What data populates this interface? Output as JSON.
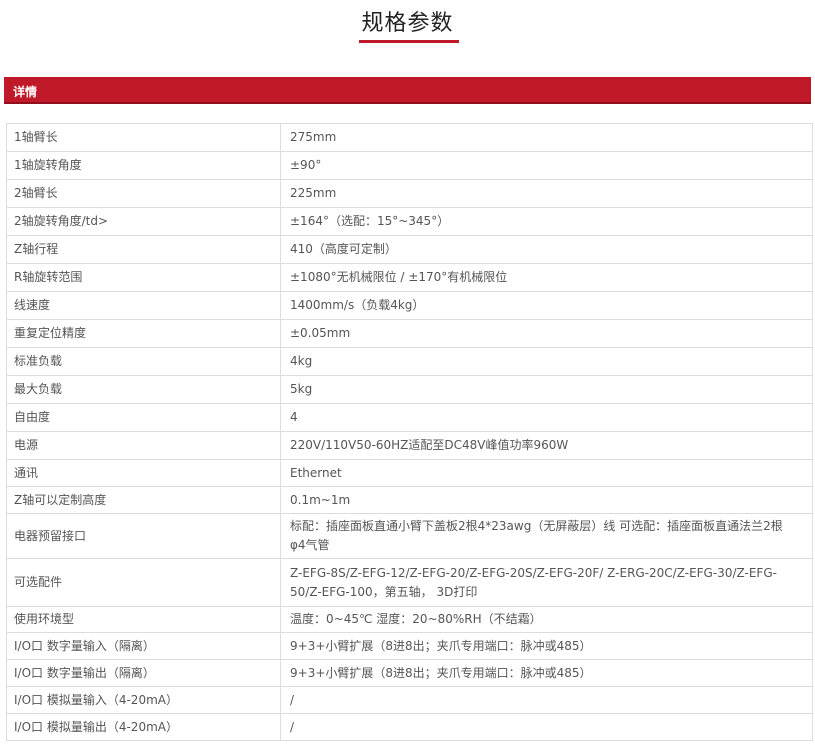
{
  "header": {
    "title": "规格参数"
  },
  "section": {
    "label": "详情"
  },
  "spec_rows": [
    {
      "key": "1轴臂长",
      "value": "275mm"
    },
    {
      "key": "1轴旋转角度",
      "value": "±90°"
    },
    {
      "key": "2轴臂长",
      "value": "225mm"
    },
    {
      "key": "2轴旋转角度/td>",
      "value": "±164°（选配：15°~345°）"
    },
    {
      "key": "Z轴行程",
      "value": "410（高度可定制）"
    },
    {
      "key": "R轴旋转范围",
      "value": "±1080°无机械限位 / ±170°有机械限位"
    },
    {
      "key": "线速度",
      "value": "1400mm/s（负载4kg）"
    },
    {
      "key": "重复定位精度",
      "value": "±0.05mm"
    },
    {
      "key": "标准负载",
      "value": "4kg"
    },
    {
      "key": "最大负载",
      "value": "5kg"
    },
    {
      "key": "自由度",
      "value": "4"
    },
    {
      "key": "电源",
      "value": "220V/110V50-60HZ适配至DC48V峰值功率960W"
    },
    {
      "key": "通讯",
      "value": "Ethernet"
    },
    {
      "key": "Z轴可以定制高度",
      "value": "0.1m~1m"
    },
    {
      "key": "电器预留接口",
      "value": "标配：插座面板直通小臂下盖板2根4*23awg（无屏蔽层）线 可选配：插座面板直通法兰2根φ4气管"
    },
    {
      "key": "可选配件",
      "value": "Z-EFG-8S/Z-EFG-12/Z-EFG-20/Z-EFG-20S/Z-EFG-20F/ Z-ERG-20C/Z-EFG-30/Z-EFG-50/Z-EFG-100，第五轴， 3D打印"
    },
    {
      "key": "使用环境型",
      "value": "温度：0~45℃ 湿度：20~80%RH（不结霜）"
    },
    {
      "key": "I/O口 数字量输入（隔离）",
      "value": "9+3+小臂扩展（8进8出；夹爪专用端口：脉冲或485）"
    },
    {
      "key": "I/O口 数字量输出（隔离）",
      "value": "9+3+小臂扩展（8进8出；夹爪专用端口：脉冲或485）"
    },
    {
      "key": "I/O口 模拟量输入（4-20mA）",
      "value": "/"
    },
    {
      "key": "I/O口 模拟量输出（4-20mA）",
      "value": "/"
    }
  ]
}
